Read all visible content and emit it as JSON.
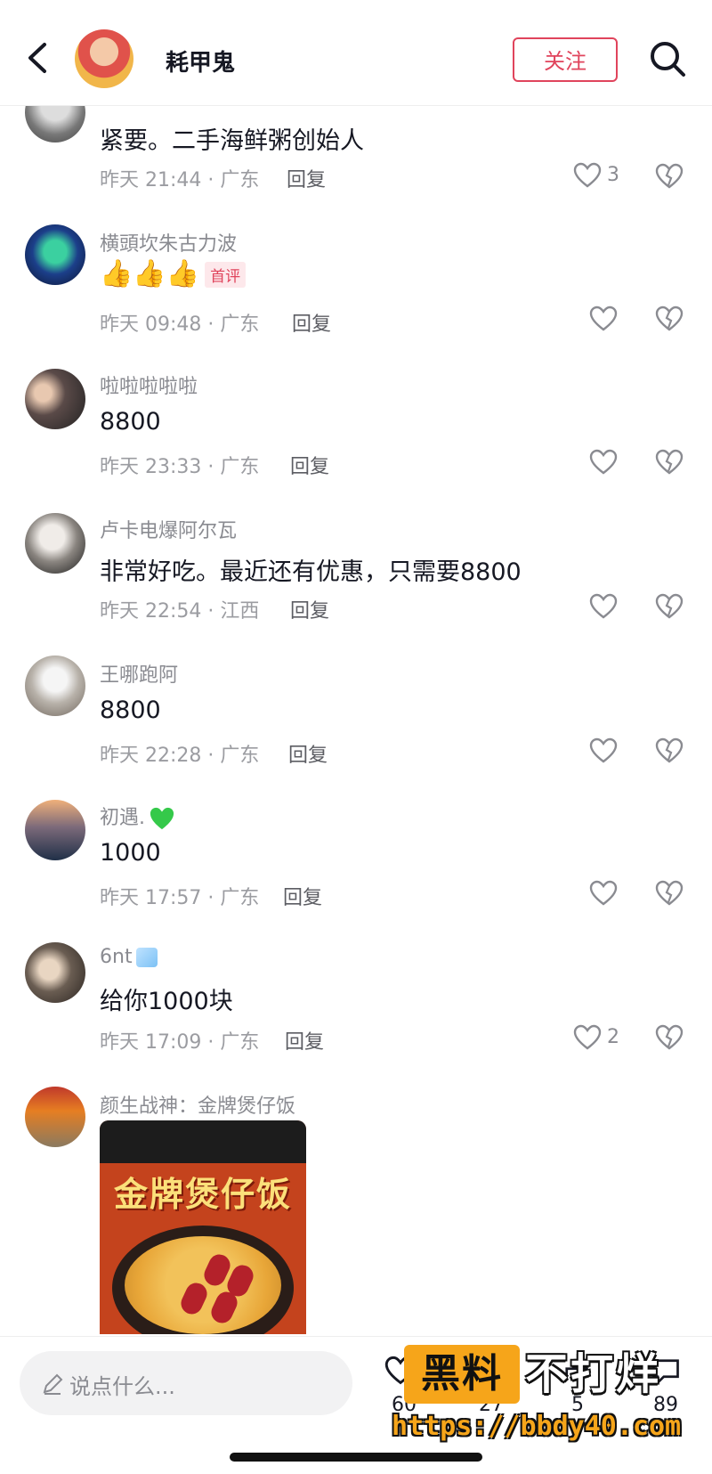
{
  "header": {
    "username": "耗甲鬼",
    "follow_label": "关注"
  },
  "comments": [
    {
      "username": "",
      "text": "紧要。二手海鲜粥创始人",
      "time": "昨天 21:44 · 广东",
      "reply_label": "回复",
      "likes": "3"
    },
    {
      "username": "横頭坎朱古力波",
      "text": "",
      "badge": "首评",
      "time": "昨天 09:48 · 广东",
      "reply_label": "回复",
      "likes": ""
    },
    {
      "username": "啦啦啦啦啦",
      "text": "8800",
      "time": "昨天 23:33 · 广东",
      "reply_label": "回复",
      "likes": ""
    },
    {
      "username": "卢卡电爆阿尔瓦",
      "text": "非常好吃。最近还有优惠，只需要8800",
      "time": "昨天 22:54 · 江西",
      "reply_label": "回复",
      "likes": ""
    },
    {
      "username": "王哪跑阿",
      "text": "8800",
      "time": "昨天 22:28 · 广东",
      "reply_label": "回复",
      "likes": ""
    },
    {
      "username": "初遇.",
      "text": "1000",
      "time": "昨天 17:57 · 广东",
      "reply_label": "回复",
      "likes": ""
    },
    {
      "username": "6nt",
      "text": "给你1000块",
      "time": "昨天 17:09 · 广东",
      "reply_label": "回复",
      "likes": "2"
    },
    {
      "username": "颜生战神：金牌煲仔饭",
      "text": "",
      "image_title": "金牌煲仔饭",
      "time": "",
      "reply_label": "",
      "likes": ""
    }
  ],
  "bottom_bar": {
    "input_placeholder": "说点什么...",
    "like_count": "60",
    "collect_count": "27",
    "share_count": "5",
    "comment_count": "89"
  },
  "watermark": {
    "box_text": "黑料",
    "text": "不打烊",
    "url": "https://bbdy40.com"
  },
  "colors": {
    "accent": "#e0445c",
    "watermark_orange": "#f6a51a"
  }
}
